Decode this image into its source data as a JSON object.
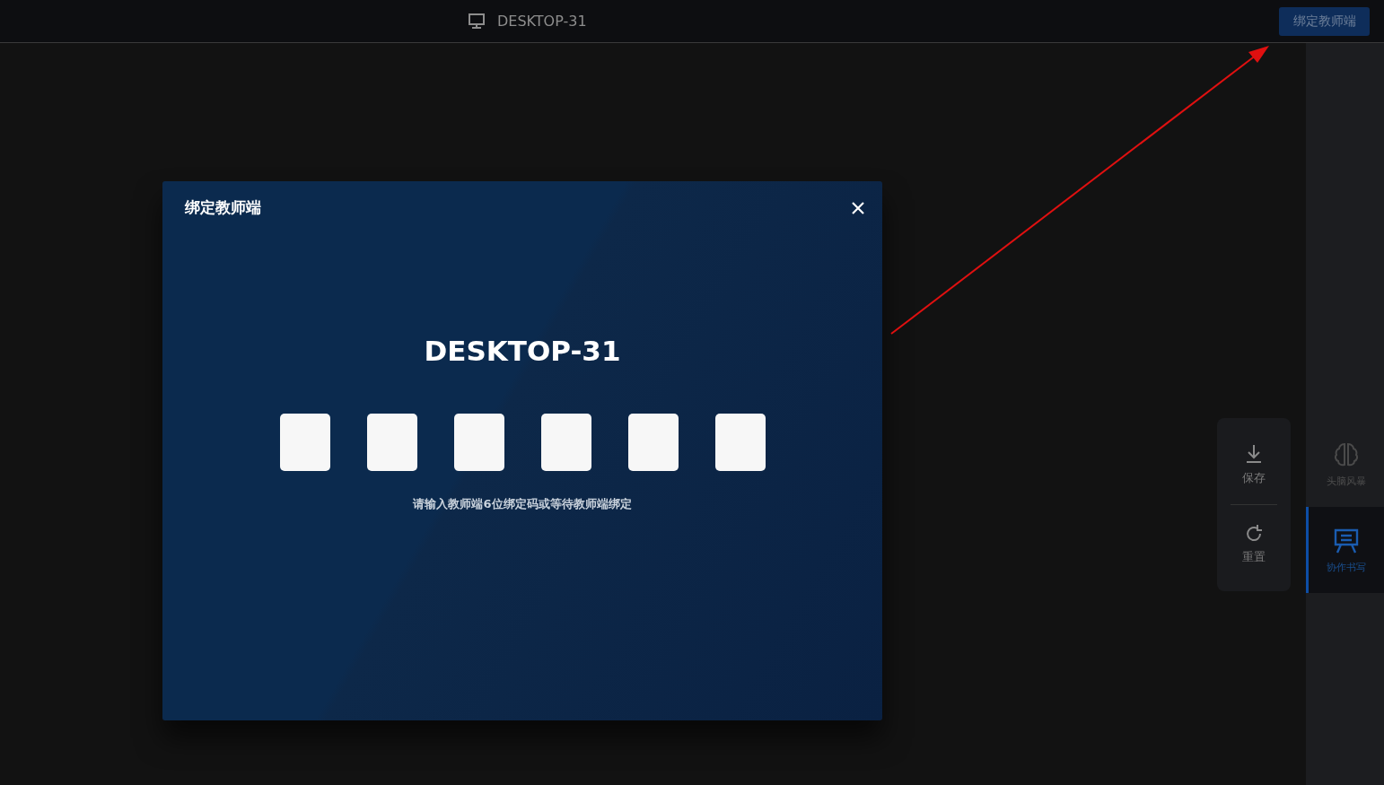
{
  "top_bar": {
    "device_name": "DESKTOP-31",
    "bind_button": "绑定教师端"
  },
  "tool_panel": {
    "buttons": [
      {
        "label": "保存",
        "kind": "save"
      },
      {
        "label": "重置",
        "kind": "reset"
      }
    ]
  },
  "sidebar": {
    "items": [
      {
        "label": "头脑风暴",
        "kind": "brain",
        "selected": false
      },
      {
        "label": "协作书写",
        "kind": "easel",
        "selected": true
      }
    ]
  },
  "dialog": {
    "title": "绑定教师端",
    "device_name": "DESKTOP-31",
    "code_fields": [
      {
        "filled": false
      },
      {
        "filled": false
      },
      {
        "filled": false
      },
      {
        "filled": false
      },
      {
        "filled": false
      },
      {
        "filled": false
      }
    ],
    "hint": "请输入教师端6位绑定码或等待教师端绑定"
  }
}
